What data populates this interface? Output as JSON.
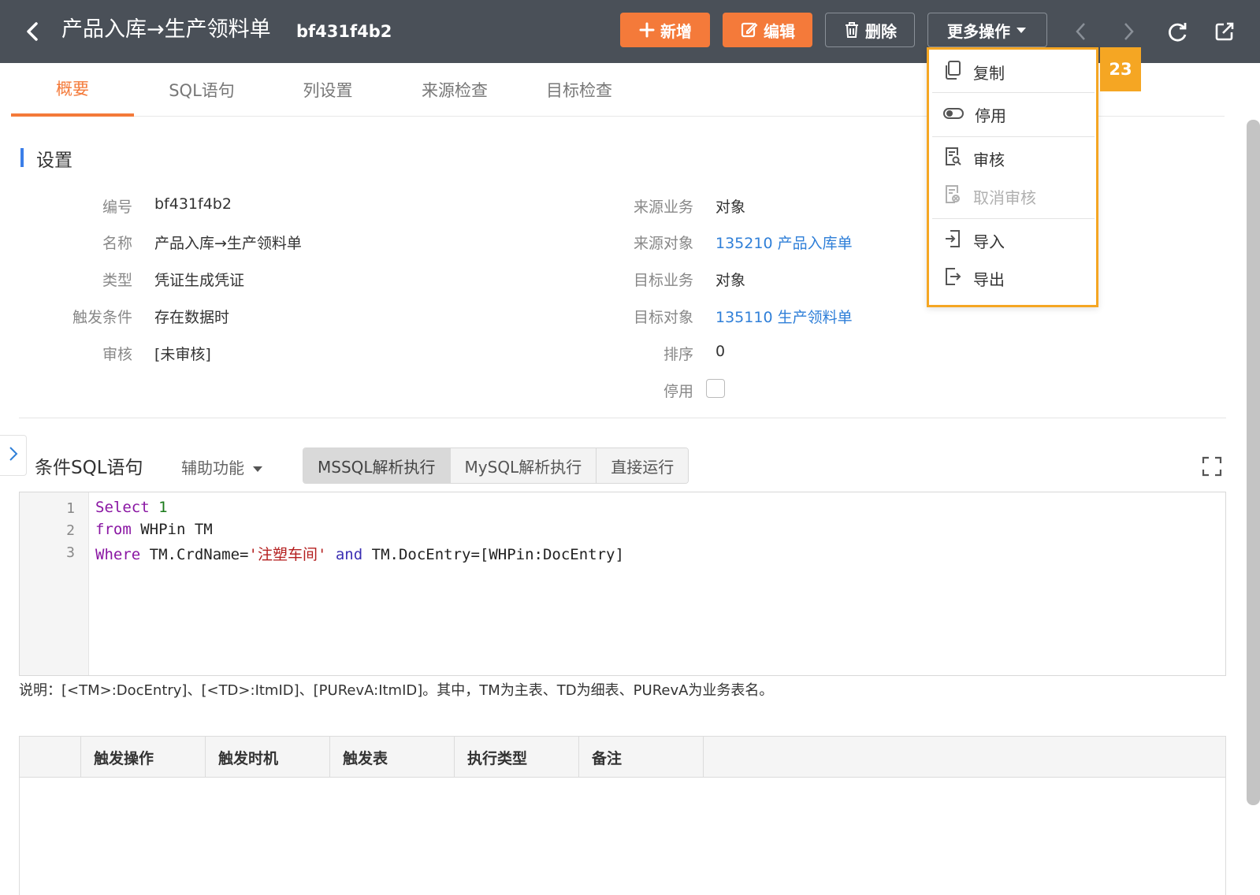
{
  "header": {
    "title": "产品入库→生产领料单",
    "code": "bf431f4b2",
    "buttons": {
      "add": "新增",
      "edit": "编辑",
      "delete": "删除",
      "more": "更多操作"
    }
  },
  "tabs": [
    "概要",
    "SQL语句",
    "列设置",
    "来源检查",
    "目标检查"
  ],
  "active_tab": "概要",
  "settings": {
    "title": "设置",
    "left": [
      {
        "label": "编号",
        "value": "bf431f4b2"
      },
      {
        "label": "名称",
        "value": "产品入库→生产领料单"
      },
      {
        "label": "类型",
        "value": "凭证生成凭证"
      },
      {
        "label": "触发条件",
        "value": "存在数据时"
      },
      {
        "label": "审核",
        "value": "[未审核]"
      }
    ],
    "right": [
      {
        "label": "来源业务",
        "value": "对象"
      },
      {
        "label": "来源对象",
        "value": "135210 产品入库单"
      },
      {
        "label": "目标业务",
        "value": "对象"
      },
      {
        "label": "目标对象",
        "value": "135110 生产领料单"
      },
      {
        "label": "排序",
        "value": "0"
      },
      {
        "label": "停用",
        "value": ""
      }
    ]
  },
  "sql": {
    "title": "条件SQL语句",
    "assist": "辅助功能",
    "modes": [
      "MSSQL解析执行",
      "MySQL解析执行",
      "直接运行"
    ],
    "active_mode": "MSSQL解析执行",
    "line_numbers": [
      "1",
      "2",
      "3"
    ],
    "line1": {
      "kw": "Select",
      "num": "1"
    },
    "line2": {
      "kw": "from",
      "rest": "WHPin TM"
    },
    "line3": {
      "kw": "Where",
      "mid": "TM.CrdName=",
      "str": "'注塑车间'",
      "kw2": "and",
      "rest": "TM.DocEntry=[WHPin:DocEntry]"
    },
    "note": "说明：[<TM>:DocEntry]、[<TD>:ItmID]、[PURevA:ItmID]。其中，TM为主表、TD为细表、PURevA为业务表名。"
  },
  "grid": {
    "columns": [
      "触发操作",
      "触发时机",
      "触发表",
      "执行类型",
      "备注"
    ]
  },
  "more_menu": {
    "items": [
      "复制",
      "停用",
      "审核",
      "取消审核",
      "导入",
      "导出"
    ],
    "badge": "23"
  },
  "colors": {
    "header_bg": "#4a5058",
    "accent": "#f47a3a",
    "link": "#2f7fd8",
    "highlight": "#f5a623"
  }
}
